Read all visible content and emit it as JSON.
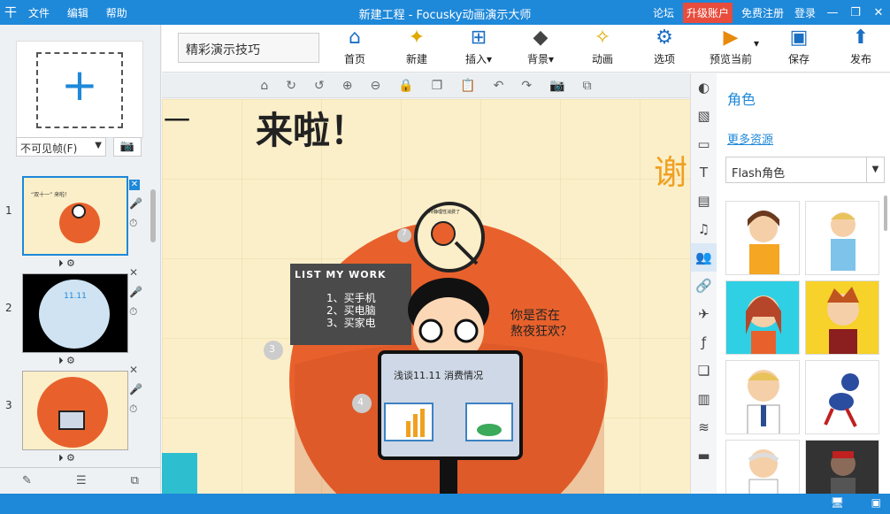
{
  "titlebar": {
    "app_icon": "fx",
    "menu": [
      "文件",
      "编辑",
      "帮助"
    ],
    "title": "新建工程 - Focusky动画演示大师",
    "links": [
      "论坛",
      "升级账户",
      "免费注册",
      "登录"
    ],
    "window_buttons": [
      "—",
      "❐",
      "✕"
    ]
  },
  "toolbar": {
    "project_name": "精彩演示技巧",
    "buttons": [
      {
        "label": "首页",
        "icon": "home-icon"
      },
      {
        "label": "新建",
        "icon": "new-icon"
      },
      {
        "label": "插入",
        "icon": "insert-icon",
        "dropdown": true
      },
      {
        "label": "背景",
        "icon": "background-icon",
        "dropdown": true
      },
      {
        "label": "动画",
        "icon": "animation-icon"
      },
      {
        "label": "选项",
        "icon": "options-icon"
      },
      {
        "label": "预览当前",
        "icon": "preview-icon",
        "dropdown": true
      },
      {
        "label": "保存",
        "icon": "save-icon"
      },
      {
        "label": "发布",
        "icon": "publish-icon"
      }
    ]
  },
  "left": {
    "frame_select": "不可见帧(F)",
    "slides": [
      {
        "num": "1",
        "title": "“双十一” 来啦！",
        "bg": "#fbefc9"
      },
      {
        "num": "2",
        "title": "11.11",
        "bg": "#000000"
      },
      {
        "num": "3",
        "title": "",
        "bg": "#fbefc9"
      }
    ]
  },
  "canvas": {
    "heading": "来啦！",
    "heading_left": "一",
    "side_text": "谢",
    "list_title": "LIST MY WORK",
    "list_items": [
      "1、买手机",
      "2、买电脑",
      "3、买家电"
    ],
    "question": [
      "你是否在",
      "熬夜狂欢？"
    ],
    "monitor_title": "浅谈11.11  消费情况",
    "badge_3": "3",
    "badge_4": "4",
    "badge_7": "7",
    "magnifier_label": "冷静理性消费了"
  },
  "right": {
    "title": "角色",
    "more": "更多资源",
    "select": "Flash角色",
    "strip_icons": [
      "shape-icon",
      "image-icon",
      "frame-icon",
      "text-icon",
      "video-icon",
      "music-icon",
      "role-icon",
      "link-icon",
      "plane-icon",
      "flash-icon",
      "layer-icon",
      "layout-icon",
      "stack-icon",
      "book-icon"
    ],
    "characters": [
      {
        "name": "woman-headset",
        "bg": "#ffffff"
      },
      {
        "name": "man-presenting",
        "bg": "#ffffff"
      },
      {
        "name": "girl-cyan",
        "bg": "#2fd0e4"
      },
      {
        "name": "boy-yellow",
        "bg": "#f6d22a"
      },
      {
        "name": "man-tie",
        "bg": "#ffffff"
      },
      {
        "name": "ant-runner",
        "bg": "#ffffff"
      },
      {
        "name": "old-doctor",
        "bg": "#ffffff"
      },
      {
        "name": "robot-dark",
        "bg": "#333333"
      }
    ]
  },
  "colors": {
    "accent": "#1e88d9",
    "orange": "#e8612c",
    "upgrade": "#e84c3d"
  }
}
